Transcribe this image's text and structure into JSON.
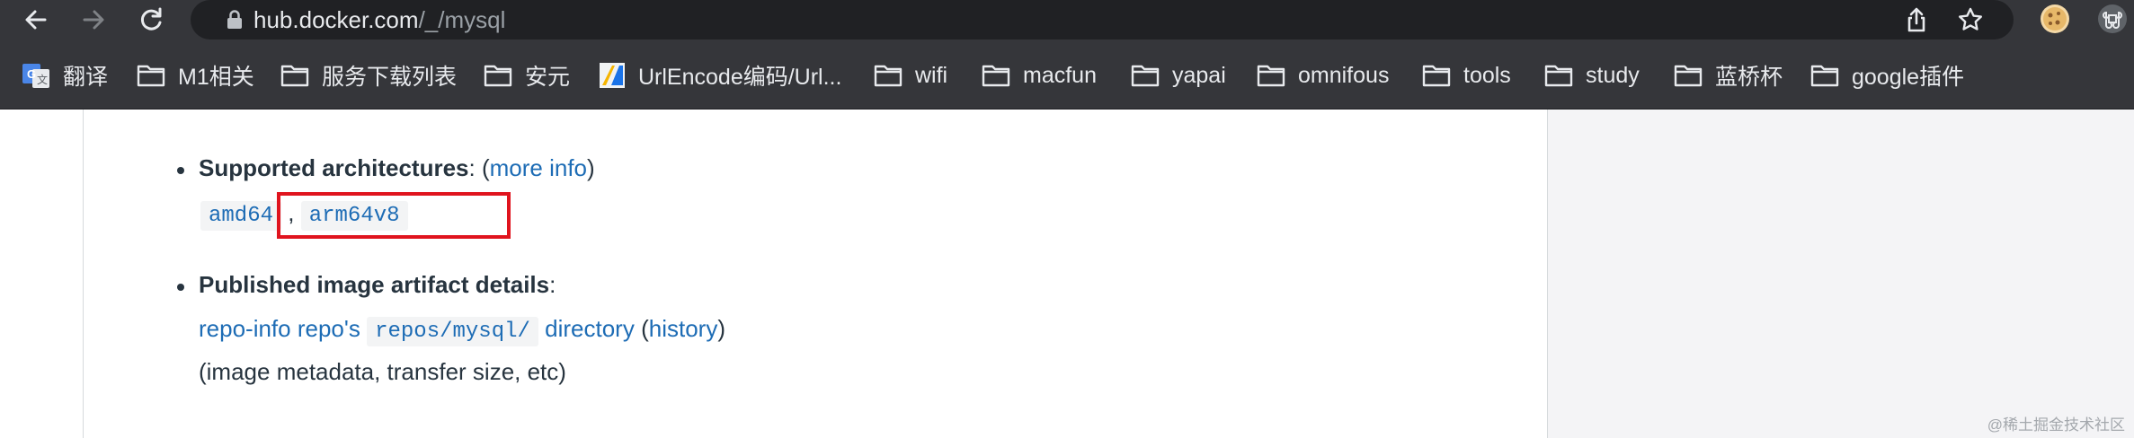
{
  "browser": {
    "url_host": "hub.docker.com",
    "url_path": "/_/mysql"
  },
  "bookmarks": [
    {
      "label": "翻译",
      "icon": "google-translate-icon"
    },
    {
      "label": "M1相关",
      "icon": "folder-icon"
    },
    {
      "label": "服务下载列表",
      "icon": "folder-icon"
    },
    {
      "label": "安元",
      "icon": "folder-icon"
    },
    {
      "label": "UrlEncode编码/Url...",
      "icon": "site-favicon"
    },
    {
      "label": "wifi",
      "icon": "folder-icon"
    },
    {
      "label": "macfun",
      "icon": "folder-icon"
    },
    {
      "label": "yapai",
      "icon": "folder-icon"
    },
    {
      "label": "omnifous",
      "icon": "folder-icon"
    },
    {
      "label": "tools",
      "icon": "folder-icon"
    },
    {
      "label": "study",
      "icon": "folder-icon"
    },
    {
      "label": "蓝桥杯",
      "icon": "folder-icon"
    },
    {
      "label": "google插件",
      "icon": "folder-icon"
    }
  ],
  "content": {
    "arch_heading": "Supported architectures",
    "arch_colon": ": (",
    "arch_more_info": "more info",
    "arch_close": ")",
    "arch_values": [
      "amd64",
      "arm64v8"
    ],
    "arch_sep": ",",
    "artifact_heading": "Published image artifact details",
    "artifact_colon": ":",
    "repo_info_link": "repo-info repo's",
    "repos_code": "repos/mysql/",
    "directory_link": "directory",
    "history_open": "(",
    "history_link": "history",
    "history_close": ")",
    "metadata_note": "(image metadata, transfer size, etc)"
  },
  "watermark": "@稀土掘金技术社区",
  "colors": {
    "chrome_bg": "#35363a",
    "omnibox_bg": "#202124",
    "link": "#1d6cb5",
    "text": "#27343f",
    "highlight_box": "#e0141e",
    "sidebar_bg": "#f4f4f6"
  }
}
